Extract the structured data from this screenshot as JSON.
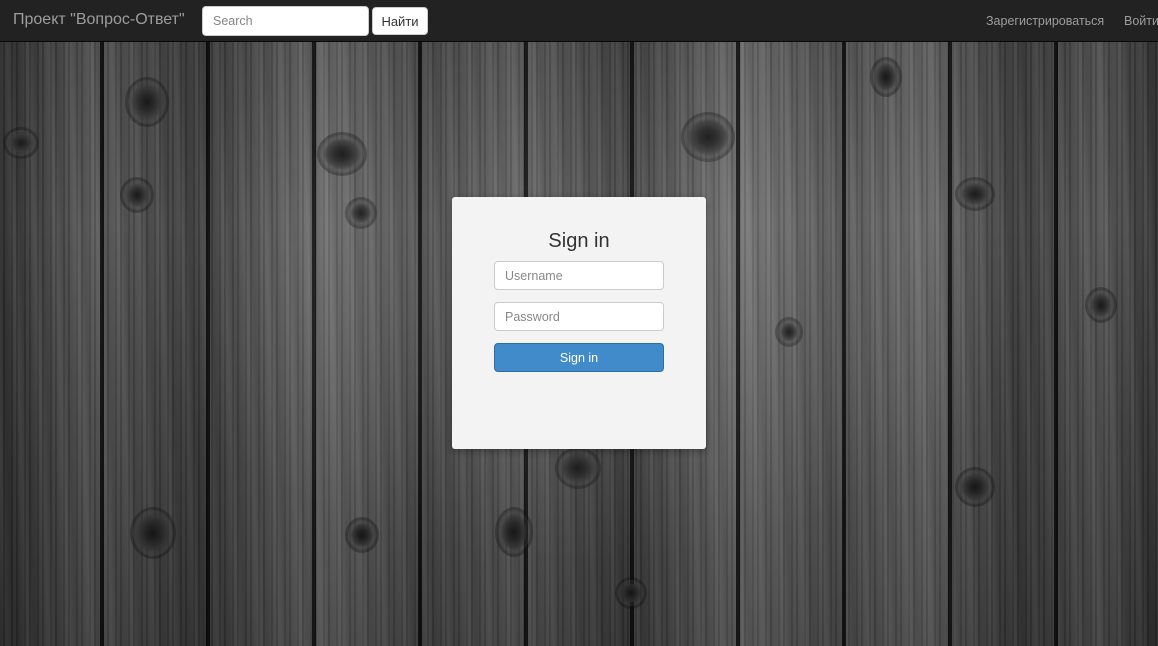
{
  "navbar": {
    "brand": "Проект \"Вопрос-Ответ\"",
    "search": {
      "placeholder": "Search",
      "value": ""
    },
    "search_button_label": "Найти",
    "links": {
      "register": "Зарегистрироваться",
      "login": "Войти"
    },
    "background_color": "#222222"
  },
  "signin_card": {
    "title": "Sign in",
    "username": {
      "placeholder": "Username",
      "value": ""
    },
    "password": {
      "placeholder": "Password",
      "value": ""
    },
    "submit_label": "Sign in",
    "accent_color": "#428bca"
  },
  "background": {
    "type": "weathered-wood-planks"
  }
}
